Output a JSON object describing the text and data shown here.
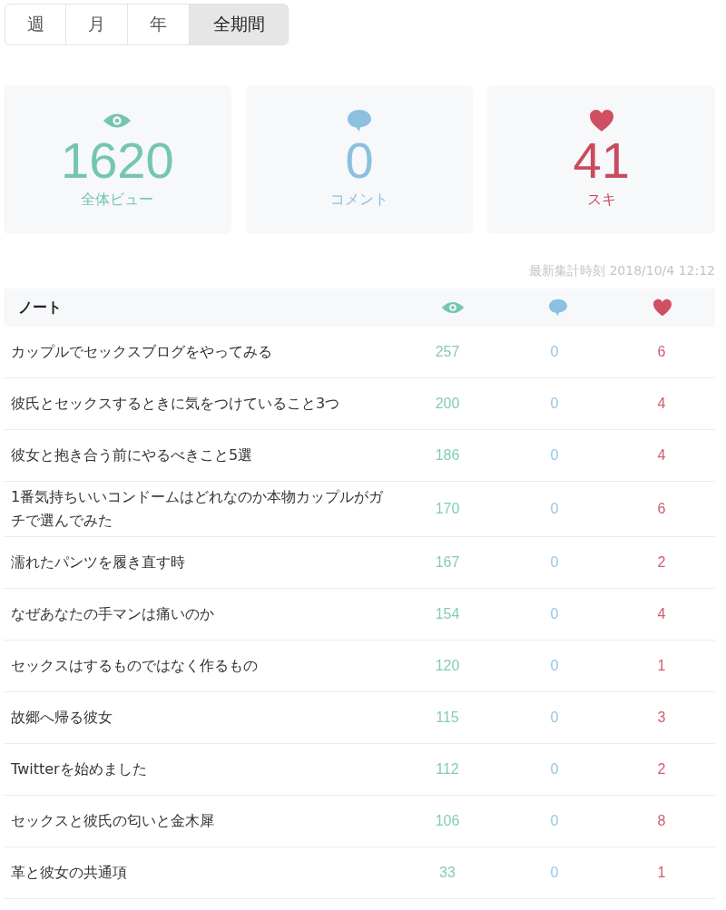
{
  "period_tabs": [
    {
      "label": "週",
      "selected": false
    },
    {
      "label": "月",
      "selected": false
    },
    {
      "label": "年",
      "selected": false
    },
    {
      "label": "全期間",
      "selected": true
    }
  ],
  "summary": [
    {
      "kind": "views",
      "value": "1620",
      "label": "全体ビュー"
    },
    {
      "kind": "comments",
      "value": "0",
      "label": "コメント"
    },
    {
      "kind": "likes",
      "value": "41",
      "label": "スキ"
    }
  ],
  "updated_at": "最新集計時刻 2018/10/4 12:12",
  "table": {
    "title_header": "ノート",
    "rows": [
      {
        "title": "カップルでセックスブログをやってみる",
        "views": "257",
        "comments": "0",
        "likes": "6"
      },
      {
        "title": "彼氏とセックスするときに気をつけていること3つ",
        "views": "200",
        "comments": "0",
        "likes": "4"
      },
      {
        "title": "彼女と抱き合う前にやるべきこと5選",
        "views": "186",
        "comments": "0",
        "likes": "4"
      },
      {
        "title": "1番気持ちいいコンドームはどれなのか本物カップルがガチで選んでみた",
        "views": "170",
        "comments": "0",
        "likes": "6"
      },
      {
        "title": "濡れたパンツを履き直す時",
        "views": "167",
        "comments": "0",
        "likes": "2"
      },
      {
        "title": "なぜあなたの手マンは痛いのか",
        "views": "154",
        "comments": "0",
        "likes": "4"
      },
      {
        "title": "セックスはするものではなく作るもの",
        "views": "120",
        "comments": "0",
        "likes": "1"
      },
      {
        "title": "故郷へ帰る彼女",
        "views": "115",
        "comments": "0",
        "likes": "3"
      },
      {
        "title": "Twitterを始めました",
        "views": "112",
        "comments": "0",
        "likes": "2"
      },
      {
        "title": "セックスと彼氏の匂いと金木犀",
        "views": "106",
        "comments": "0",
        "likes": "8"
      },
      {
        "title": "革と彼女の共通項",
        "views": "33",
        "comments": "0",
        "likes": "1"
      }
    ]
  }
}
